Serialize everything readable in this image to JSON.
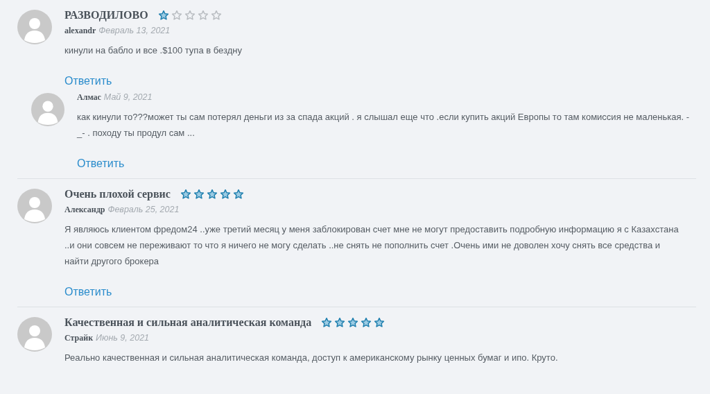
{
  "comments": [
    {
      "title": "РАЗВОДИЛОВО",
      "stars": 1,
      "author": "alexandr",
      "date": "Февраль 13, 2021",
      "text": "кинули на бабло и все .$100 тупа в бездну",
      "reply_label": "Ответить",
      "replies": [
        {
          "author": "Алмас",
          "date": "Май 9, 2021",
          "text": "как кинули то???может ты сам потерял деньги из за спада акций . я слышал еще что .если купить акций Европы то там комиссия не маленькая. -_- . походу ты продул сам ...",
          "reply_label": "Ответить"
        }
      ]
    },
    {
      "title": "Очень плохой сервис",
      "stars": 5,
      "author": "Александр",
      "date": "Февраль 25, 2021",
      "text": "Я являюсь клиентом фредом24 ..уже третий месяц у меня заблокирован счет мне не могут предоставить подробную информацию я с Казахстана ..и они совсем не переживают то что я ничего не могу сделать ..не снять не пополнить счет .Очень ими не доволен хочу снять все средства и найти другого брокера",
      "reply_label": "Ответить"
    },
    {
      "title": "Качественная и сильная аналитическая команда",
      "stars": 5,
      "author": "Страйк",
      "date": "Июнь 9, 2021",
      "text": "Реально качественная и сильная аналитическая команда, доступ к американскому рынку ценных бумаг и ипо. Круто."
    }
  ]
}
